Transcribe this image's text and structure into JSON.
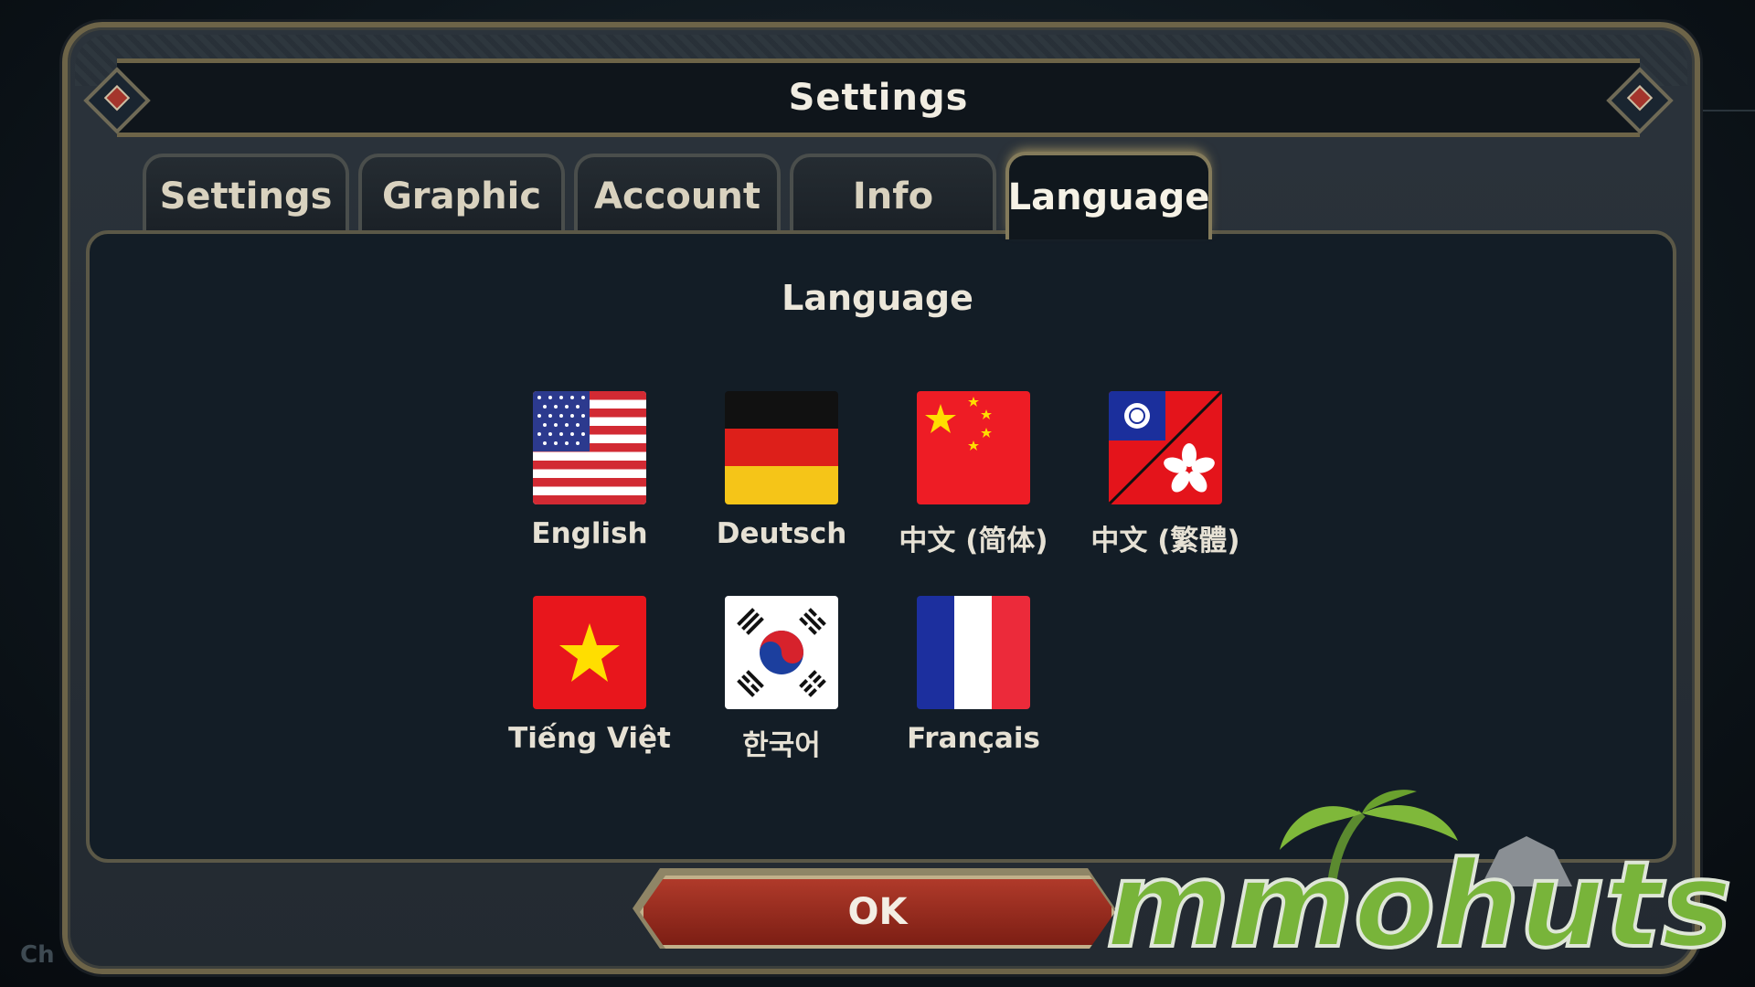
{
  "window": {
    "title": "Settings"
  },
  "tabs": [
    {
      "label": "Settings",
      "active": false
    },
    {
      "label": "Graphic",
      "active": false
    },
    {
      "label": "Account",
      "active": false
    },
    {
      "label": "Info",
      "active": false
    },
    {
      "label": "Language",
      "active": true
    }
  ],
  "panel": {
    "title": "Language"
  },
  "languages": [
    {
      "label": "English",
      "icon": "us-flag-icon"
    },
    {
      "label": "Deutsch",
      "icon": "germany-flag-icon"
    },
    {
      "label": "中文 (简体)",
      "icon": "china-flag-icon"
    },
    {
      "label": "中文 (繁體)",
      "icon": "taiwan-hongkong-flag-icon"
    },
    {
      "label": "Tiếng Việt",
      "icon": "vietnam-flag-icon"
    },
    {
      "label": "한국어",
      "icon": "korea-flag-icon"
    },
    {
      "label": "Français",
      "icon": "france-flag-icon"
    }
  ],
  "ok_button": {
    "label": "OK"
  },
  "corner_text": "Ch",
  "watermark": {
    "logo_text": "mmohuts"
  },
  "colors": {
    "accent_gold": "#6d6448",
    "ok_red": "#9c2c1f",
    "panel_bg": "#131d26"
  }
}
